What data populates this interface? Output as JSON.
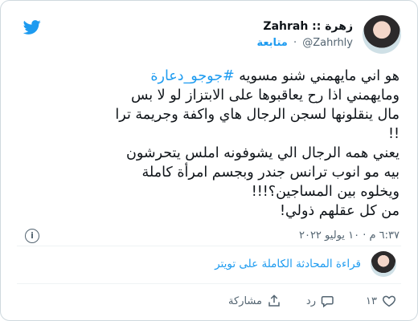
{
  "tweet": {
    "display_name": "زهرة :: Zahrah",
    "handle": "@Zahrhly",
    "follow_label": "متابعة",
    "hashtag": "#جوجو_دعارة",
    "lines": [
      "هو اني مايهمني شنو مسويه",
      "ومايهمني اذا رح يعاقبوها على الابتزاز لو لا بس",
      "مال ينقلونها لسجن الرجال هاي واكفة وجريمة ترا",
      "!!",
      "يعني همه الرجال الي يشوفونه املس يتحرشون",
      "بيه مو انوب ترانس جندر وبجسم امرأة كاملة",
      "ويخلوه بين المساجين؟!!!",
      "من كل عقلهم ذولي!"
    ],
    "timestamp": "٦:٣٧ م · ١٠ يوليو ٢٠٢٢",
    "thread_link": "قراءة المحادثة الكاملة على تويتر",
    "actions": {
      "like_count": "١٣",
      "reply_label": "رد",
      "share_label": "مشاركة"
    },
    "colors": {
      "accent": "#1d9bf0",
      "muted": "#536471",
      "text": "#0f1419"
    }
  }
}
